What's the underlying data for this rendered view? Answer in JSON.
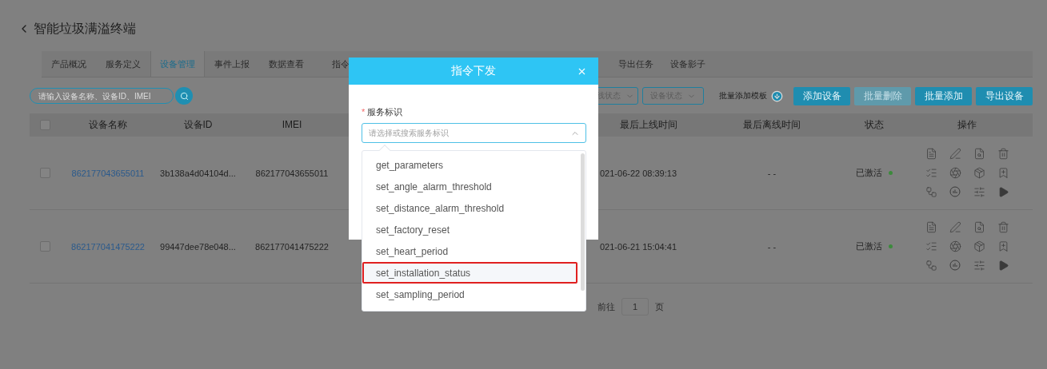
{
  "header": {
    "title": "智能垃圾满溢终端"
  },
  "tabs": [
    {
      "label": "产品概况",
      "selected": false
    },
    {
      "label": "服务定义",
      "selected": false
    },
    {
      "label": "设备管理",
      "selected": true
    },
    {
      "label": "事件上报",
      "selected": false
    },
    {
      "label": "数据查看",
      "selected": false
    },
    {
      "label": "指令",
      "selected": false
    },
    {
      "label": "导出任务",
      "selected": false
    },
    {
      "label": "设备影子",
      "selected": false
    }
  ],
  "toolbar": {
    "search": {
      "placeholder": "请输入设备名称、设备ID、IMEI"
    },
    "filters": [
      {
        "label": "线状态"
      },
      {
        "label": "设备状态"
      }
    ],
    "template_link": "批量添加模板",
    "buttons": [
      {
        "label": "添加设备",
        "disabled": false
      },
      {
        "label": "批量删除",
        "disabled": true
      },
      {
        "label": "批量添加",
        "disabled": false
      },
      {
        "label": "导出设备",
        "disabled": false
      }
    ]
  },
  "table": {
    "select_all_checked": false,
    "columns": [
      "设备名称",
      "设备ID",
      "IMEI",
      "最后上线时间",
      "最后离线时间",
      "状态",
      "操作"
    ],
    "rows": [
      {
        "checked": false,
        "name": "862177043655011",
        "device_id": "3b138a4d04104d...",
        "imei": "862177043655011",
        "last_online": "021-06-22 08:39:13",
        "last_offline": "- -",
        "status": "已激活"
      },
      {
        "checked": false,
        "name": "862177041475222",
        "device_id": "99447dee78e048...",
        "imei": "862177041475222",
        "last_online": "021-06-21 15:04:41",
        "last_offline": "- -",
        "status": "已激活"
      }
    ]
  },
  "pagination": {
    "goto_label": "前往",
    "page": "1",
    "page_suffix": "页"
  },
  "dialog": {
    "title": "指令下发",
    "field": {
      "label": "服务标识",
      "required_mark": "*",
      "placeholder": "请选择或搜索服务标识"
    },
    "options": [
      {
        "label": "get_parameters",
        "highlighted": false
      },
      {
        "label": "set_angle_alarm_threshold",
        "highlighted": false
      },
      {
        "label": "set_distance_alarm_threshold",
        "highlighted": false
      },
      {
        "label": "set_factory_reset",
        "highlighted": false
      },
      {
        "label": "set_heart_period",
        "highlighted": false
      },
      {
        "label": "set_installation_status",
        "highlighted": true
      },
      {
        "label": "set_sampling_period",
        "highlighted": false
      }
    ]
  }
}
